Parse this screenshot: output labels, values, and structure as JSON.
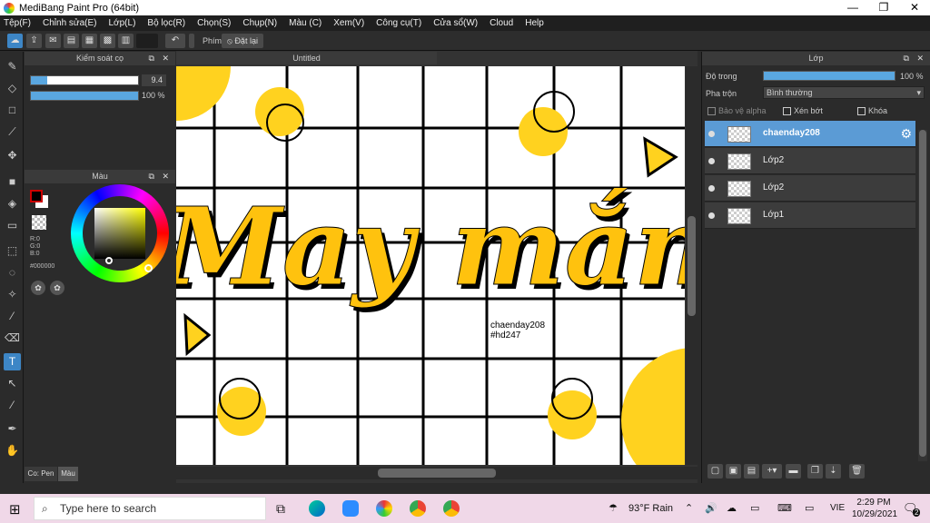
{
  "window": {
    "title": "MediBang Paint Pro (64bit)",
    "minimize": "—",
    "maximize": "❐",
    "close": "✕"
  },
  "menu": [
    "Tệp(F)",
    "Chỉnh sửa(E)",
    "Lớp(L)",
    "Bộ lọc(R)",
    "Chọn(S)",
    "Chụp(N)",
    "Màu (C)",
    "Xem(V)",
    "Công cụ(T)",
    "Cửa sổ(W)",
    "Cloud",
    "Help"
  ],
  "toolbar": {
    "undo_icon": "undo-icon",
    "hotkey_label": "Phím",
    "reset_label": "Đặt lại"
  },
  "brush_panel": {
    "title": "Kiểm soát cọ",
    "size_value": "9.4",
    "size_fill": 0.15,
    "opacity_value": "100 %",
    "opacity_fill": 1.0
  },
  "color_panel": {
    "title": "Màu",
    "r": "R:0",
    "g": "G:0",
    "b": "B:0",
    "hex": "#000000",
    "fg_color": "#000000",
    "bg_color": "#ffffff"
  },
  "bottom_tabs": [
    "Co: Pen",
    "Màu"
  ],
  "document": {
    "tab_title": "Untitled",
    "main_text": "May mắn",
    "tag_user": "chaenday208",
    "tag_hash": "#hd247",
    "accent": "#ffc20e"
  },
  "layer_panel": {
    "title": "Lớp",
    "opacity_label": "Độ trong",
    "opacity_value": "100 %",
    "opacity_fill": 1.0,
    "blend_label": "Pha trộn",
    "blend_value": "Bình thường",
    "protect_alpha": "Bảo vệ alpha",
    "clipping": "Xén bớt",
    "lock": "Khóa",
    "layers": [
      {
        "name": "chaenday208",
        "active": true
      },
      {
        "name": "Lớp2",
        "active": false
      },
      {
        "name": "Lớp2",
        "active": false
      },
      {
        "name": "Lớp1",
        "active": false
      }
    ]
  },
  "taskbar": {
    "search_placeholder": "Type here to search",
    "weather": "93°F  Rain",
    "lang": "VIE",
    "time": "2:29 PM",
    "date": "10/29/2021",
    "notif_count": "2"
  }
}
